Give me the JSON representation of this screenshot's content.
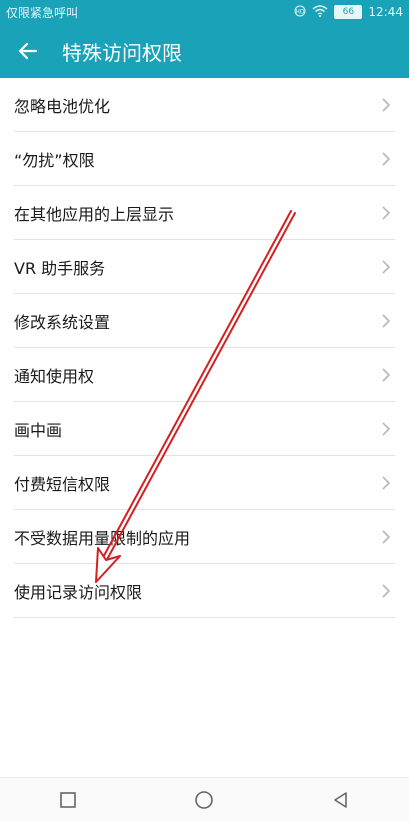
{
  "status_bar": {
    "carrier_text": "仅限紧急呼叫",
    "battery_level": "66",
    "time": "12:44",
    "icons": [
      "hd-icon",
      "wifi-icon",
      "battery-icon"
    ]
  },
  "app_bar": {
    "title": "特殊访问权限",
    "back_icon": "arrow-left-icon",
    "background_color": "#1aa2b8"
  },
  "list": {
    "items": [
      {
        "label": "忽略电池优化"
      },
      {
        "label": "“勿扰”权限"
      },
      {
        "label": "在其他应用的上层显示"
      },
      {
        "label": "VR 助手服务"
      },
      {
        "label": "修改系统设置"
      },
      {
        "label": "通知使用权"
      },
      {
        "label": "画中画"
      },
      {
        "label": "付费短信权限"
      },
      {
        "label": "不受数据用量限制的应用"
      },
      {
        "label": "使用记录访问权限"
      }
    ]
  },
  "nav_bar": {
    "icons": [
      "square-recents-icon",
      "circle-home-icon",
      "triangle-back-icon"
    ]
  },
  "annotation": {
    "arrow_color": "#d42020"
  }
}
